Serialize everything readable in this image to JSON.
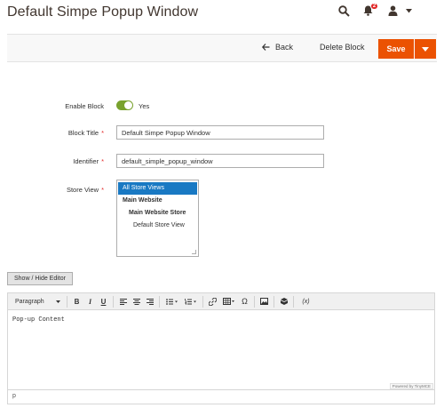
{
  "header": {
    "title": "Default Simpe Popup Window",
    "notification_count": "2",
    "icons": [
      "search-icon",
      "bell-icon",
      "user-icon",
      "caret-down-icon"
    ]
  },
  "actions": {
    "back_label": "Back",
    "delete_label": "Delete Block",
    "save_label": "Save",
    "accent_color": "#eb5202"
  },
  "form": {
    "enable_block": {
      "label": "Enable Block",
      "value": "Yes",
      "on": true
    },
    "block_title": {
      "label": "Block Title",
      "value": "Default Simpe Popup Window"
    },
    "identifier": {
      "label": "Identifier",
      "value": "default_simple_popup_window"
    },
    "store_view": {
      "label": "Store View",
      "options": [
        {
          "label": "All Store Views",
          "selected": true
        },
        {
          "label": "Main Website",
          "selected": false
        },
        {
          "label": "Main Website Store",
          "selected": false
        },
        {
          "label": "Default Store View",
          "selected": false
        }
      ]
    }
  },
  "editor": {
    "toggle_label": "Show / Hide Editor",
    "format_select": "Paragraph",
    "toolbar_icons": [
      "bold-icon",
      "italic-icon",
      "underline-icon",
      "align-left-icon",
      "align-center-icon",
      "align-right-icon",
      "bullet-list-icon",
      "numbered-list-icon",
      "link-icon",
      "table-icon",
      "special-char-icon",
      "image-icon",
      "widget-icon",
      "variable-icon"
    ],
    "content": "Pop-up Content",
    "powered_by": "Powered by TinyMCE",
    "status_path": "p"
  }
}
